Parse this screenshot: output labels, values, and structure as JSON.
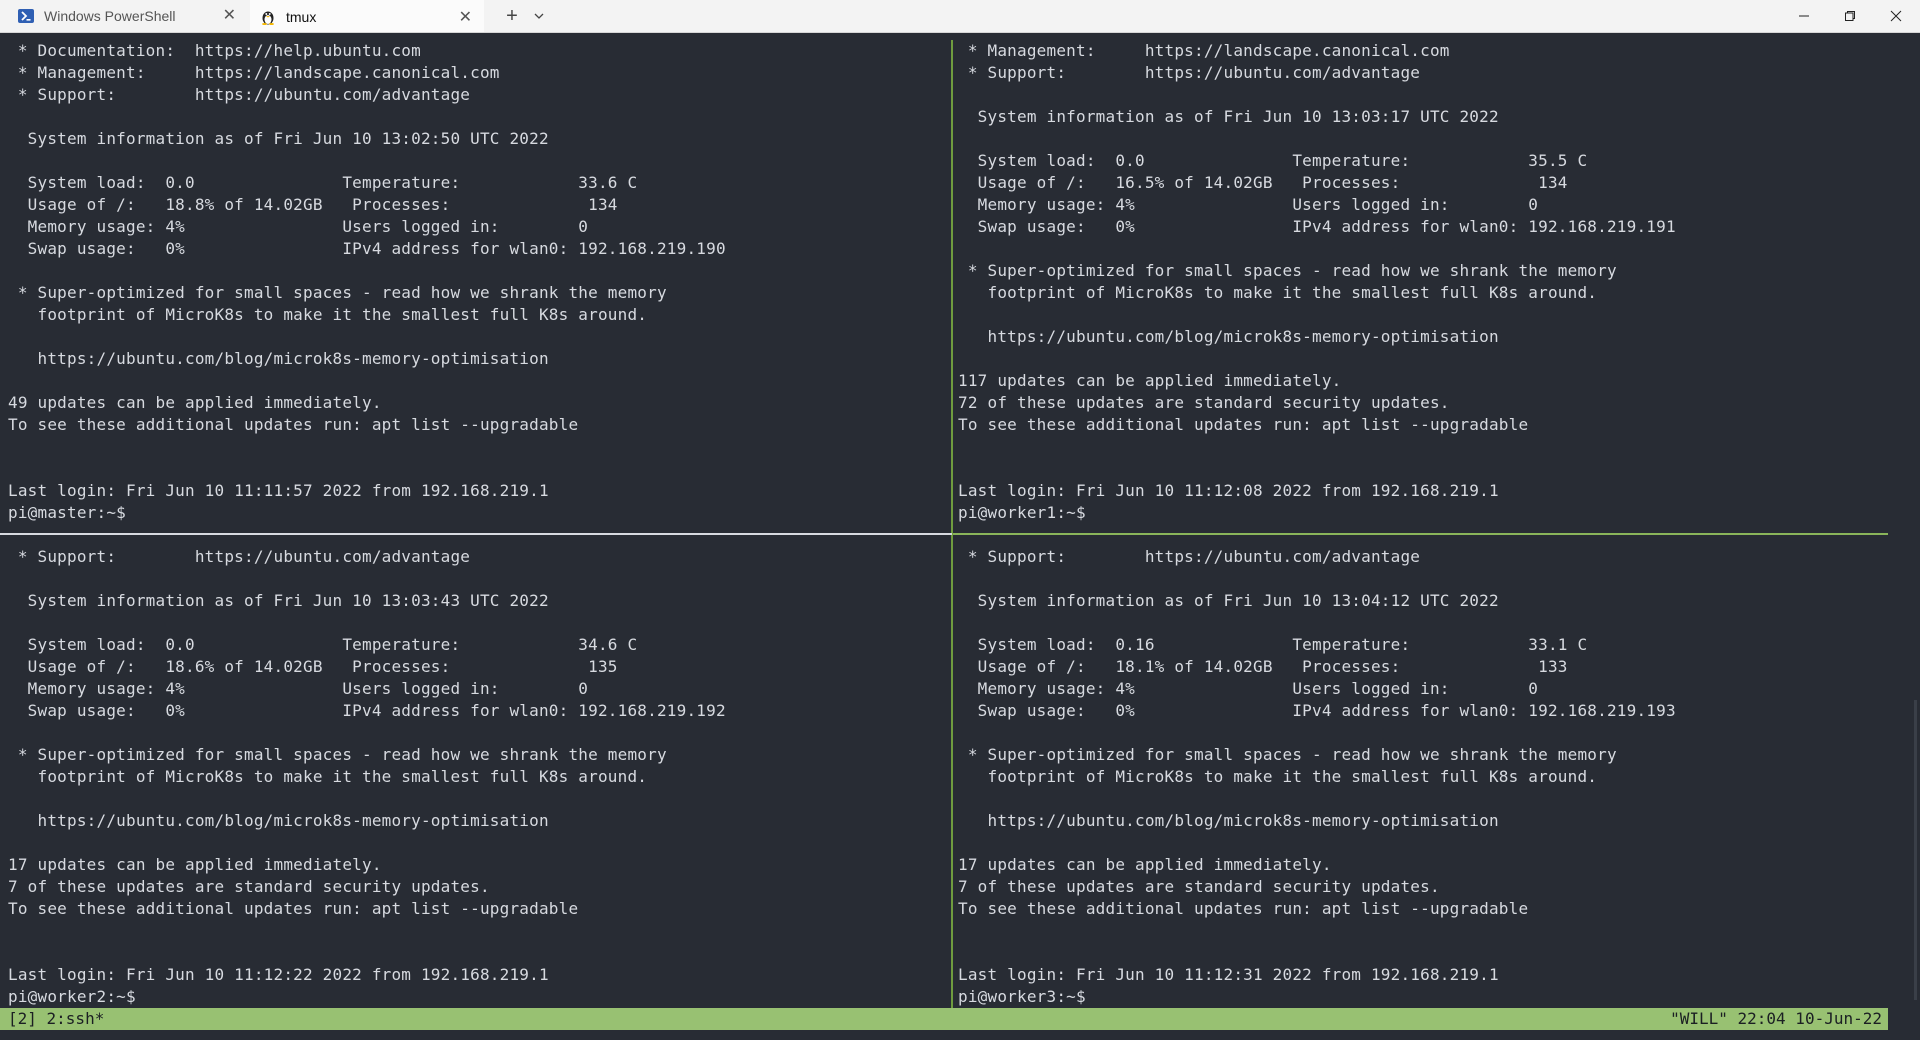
{
  "window": {
    "tabs": [
      {
        "label": "Windows PowerShell",
        "icon": "powershell-icon",
        "active": false
      },
      {
        "label": "tmux",
        "icon": "linux-penguin-icon",
        "active": true
      }
    ],
    "new_tab": "+",
    "controls": {
      "minimize": "—",
      "maximize": "❐",
      "close": "✕"
    }
  },
  "panes": {
    "master": {
      "lines": [
        " * Documentation:  https://help.ubuntu.com",
        " * Management:     https://landscape.canonical.com",
        " * Support:        https://ubuntu.com/advantage",
        "",
        "  System information as of Fri Jun 10 13:02:50 UTC 2022",
        "",
        "  System load:  0.0               Temperature:            33.6 C",
        "  Usage of /:   18.8% of 14.02GB   Processes:              134",
        "  Memory usage: 4%                Users logged in:        0",
        "  Swap usage:   0%                IPv4 address for wlan0: 192.168.219.190",
        "",
        " * Super-optimized for small spaces - read how we shrank the memory",
        "   footprint of MicroK8s to make it the smallest full K8s around.",
        "",
        "   https://ubuntu.com/blog/microk8s-memory-optimisation",
        "",
        "49 updates can be applied immediately.",
        "To see these additional updates run: apt list --upgradable",
        "",
        "",
        "Last login: Fri Jun 10 11:11:57 2022 from 192.168.219.1",
        "pi@master:~$"
      ]
    },
    "worker1": {
      "lines": [
        " * Management:     https://landscape.canonical.com",
        " * Support:        https://ubuntu.com/advantage",
        "",
        "  System information as of Fri Jun 10 13:03:17 UTC 2022",
        "",
        "  System load:  0.0               Temperature:            35.5 C",
        "  Usage of /:   16.5% of 14.02GB   Processes:              134",
        "  Memory usage: 4%                Users logged in:        0",
        "  Swap usage:   0%                IPv4 address for wlan0: 192.168.219.191",
        "",
        " * Super-optimized for small spaces - read how we shrank the memory",
        "   footprint of MicroK8s to make it the smallest full K8s around.",
        "",
        "   https://ubuntu.com/blog/microk8s-memory-optimisation",
        "",
        "117 updates can be applied immediately.",
        "72 of these updates are standard security updates.",
        "To see these additional updates run: apt list --upgradable",
        "",
        "",
        "Last login: Fri Jun 10 11:12:08 2022 from 192.168.219.1",
        "pi@worker1:~$"
      ]
    },
    "worker2": {
      "lines": [
        " * Support:        https://ubuntu.com/advantage",
        "",
        "  System information as of Fri Jun 10 13:03:43 UTC 2022",
        "",
        "  System load:  0.0               Temperature:            34.6 C",
        "  Usage of /:   18.6% of 14.02GB   Processes:              135",
        "  Memory usage: 4%                Users logged in:        0",
        "  Swap usage:   0%                IPv4 address for wlan0: 192.168.219.192",
        "",
        " * Super-optimized for small spaces - read how we shrank the memory",
        "   footprint of MicroK8s to make it the smallest full K8s around.",
        "",
        "   https://ubuntu.com/blog/microk8s-memory-optimisation",
        "",
        "17 updates can be applied immediately.",
        "7 of these updates are standard security updates.",
        "To see these additional updates run: apt list --upgradable",
        "",
        "",
        "Last login: Fri Jun 10 11:12:22 2022 from 192.168.219.1",
        "pi@worker2:~$"
      ]
    },
    "worker3": {
      "lines": [
        " * Support:        https://ubuntu.com/advantage",
        "",
        "  System information as of Fri Jun 10 13:04:12 UTC 2022",
        "",
        "  System load:  0.16              Temperature:            33.1 C",
        "  Usage of /:   18.1% of 14.02GB   Processes:              133",
        "  Memory usage: 4%                Users logged in:        0",
        "  Swap usage:   0%                IPv4 address for wlan0: 192.168.219.193",
        "",
        " * Super-optimized for small spaces - read how we shrank the memory",
        "   footprint of MicroK8s to make it the smallest full K8s around.",
        "",
        "   https://ubuntu.com/blog/microk8s-memory-optimisation",
        "",
        "17 updates can be applied immediately.",
        "7 of these updates are standard security updates.",
        "To see these additional updates run: apt list --upgradable",
        "",
        "",
        "Last login: Fri Jun 10 11:12:31 2022 from 192.168.219.1",
        "pi@worker3:~$"
      ]
    }
  },
  "status": {
    "left": "[2] 2:ssh*",
    "right": "\"WILL\" 22:04 10-Jun-22"
  },
  "colors": {
    "terminal_bg": "#282c34",
    "terminal_fg": "#d7dae0",
    "status_bg": "#98c172",
    "active_border": "#8ab55a"
  }
}
